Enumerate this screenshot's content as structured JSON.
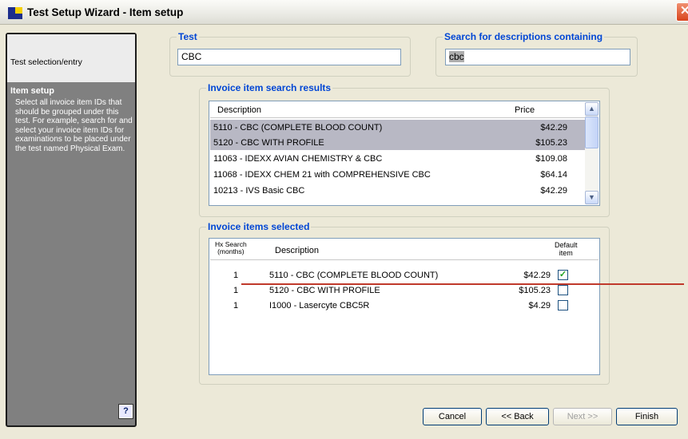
{
  "window": {
    "title": "Test Setup Wizard - Item setup",
    "close_glyph": "✕"
  },
  "sidebar": {
    "steps": [
      "Test selection/entry"
    ],
    "current_heading": "Item setup",
    "current_description": "Select all invoice item IDs that should be grouped under this test. For example, search for and select your invoice item IDs for examinations to be placed under the test named Physical Exam.",
    "help_label": "?"
  },
  "test": {
    "label": "Test",
    "value": "CBC"
  },
  "search": {
    "label": "Search for descriptions containing",
    "value": "cbc"
  },
  "results": {
    "label": "Invoice item search results",
    "columns": {
      "description": "Description",
      "price": "Price"
    },
    "rows": [
      {
        "description": "5110 - CBC (COMPLETE BLOOD COUNT)",
        "price": "$42.29",
        "selected": true
      },
      {
        "description": "5120 - CBC WITH PROFILE",
        "price": "$105.23",
        "selected": true
      },
      {
        "description": "11063 - IDEXX AVIAN CHEMISTRY & CBC",
        "price": "$109.08",
        "selected": false
      },
      {
        "description": "11068 - IDEXX CHEM 21 with COMPREHENSIVE CBC",
        "price": "$64.14",
        "selected": false
      },
      {
        "description": "10213 - IVS Basic CBC",
        "price": "$42.29",
        "selected": false
      }
    ]
  },
  "selected_items": {
    "label": "Invoice items selected",
    "columns": {
      "hx_search_line1": "Hx Search",
      "hx_search_line2": "(months)",
      "description": "Description",
      "default_line1": "Default",
      "default_line2": "item"
    },
    "rows": [
      {
        "hx": "1",
        "description": "5110 - CBC (COMPLETE BLOOD COUNT)",
        "price": "$42.29",
        "default": true
      },
      {
        "hx": "1",
        "description": "5120 - CBC WITH PROFILE",
        "price": "$105.23",
        "default": false
      },
      {
        "hx": "1",
        "description": "I1000 - Lasercyte CBC5R",
        "price": "$4.29",
        "default": false
      }
    ]
  },
  "buttons": {
    "cancel": "Cancel",
    "back": "<< Back",
    "next": "Next >>",
    "finish": "Finish"
  },
  "colors": {
    "group_label": "#0046d5",
    "sidebar_bg": "#808080",
    "annotation_line": "#c0392b"
  }
}
